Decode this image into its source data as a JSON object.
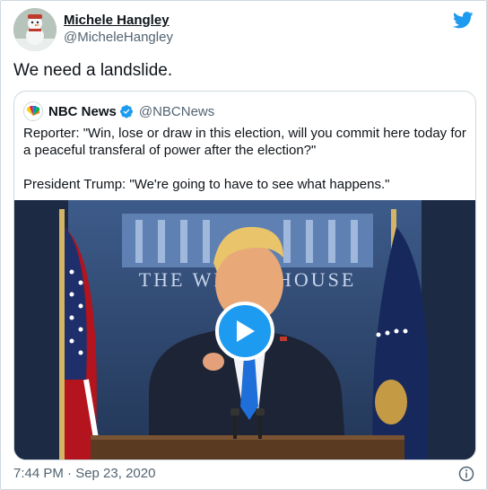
{
  "author": {
    "name": "Michele Hangley",
    "handle": "@MicheleHangley"
  },
  "tweet": {
    "text": "We need a landslide.",
    "timestamp": "7:44 PM · Sep 23, 2020"
  },
  "quoted_tweet": {
    "author_name": "NBC News",
    "author_handle": "@NBCNews",
    "paragraphs": [
      "Reporter: \"Win, lose or draw in this election, will you commit here today for a peaceful transferal of power after the election?\"",
      "President Trump: \"We're going to have to see what happens.\""
    ]
  },
  "video": {
    "backdrop_text": "THE WHITE HOUSE"
  },
  "icons": {
    "brand": "twitter-bird-icon",
    "play": "play-icon",
    "info": "info-icon",
    "verified": "verified-badge-icon"
  },
  "colors": {
    "accent": "#1d9bf0",
    "text": "#0f1419",
    "secondary_text": "#536471",
    "border": "#cfd9de"
  }
}
